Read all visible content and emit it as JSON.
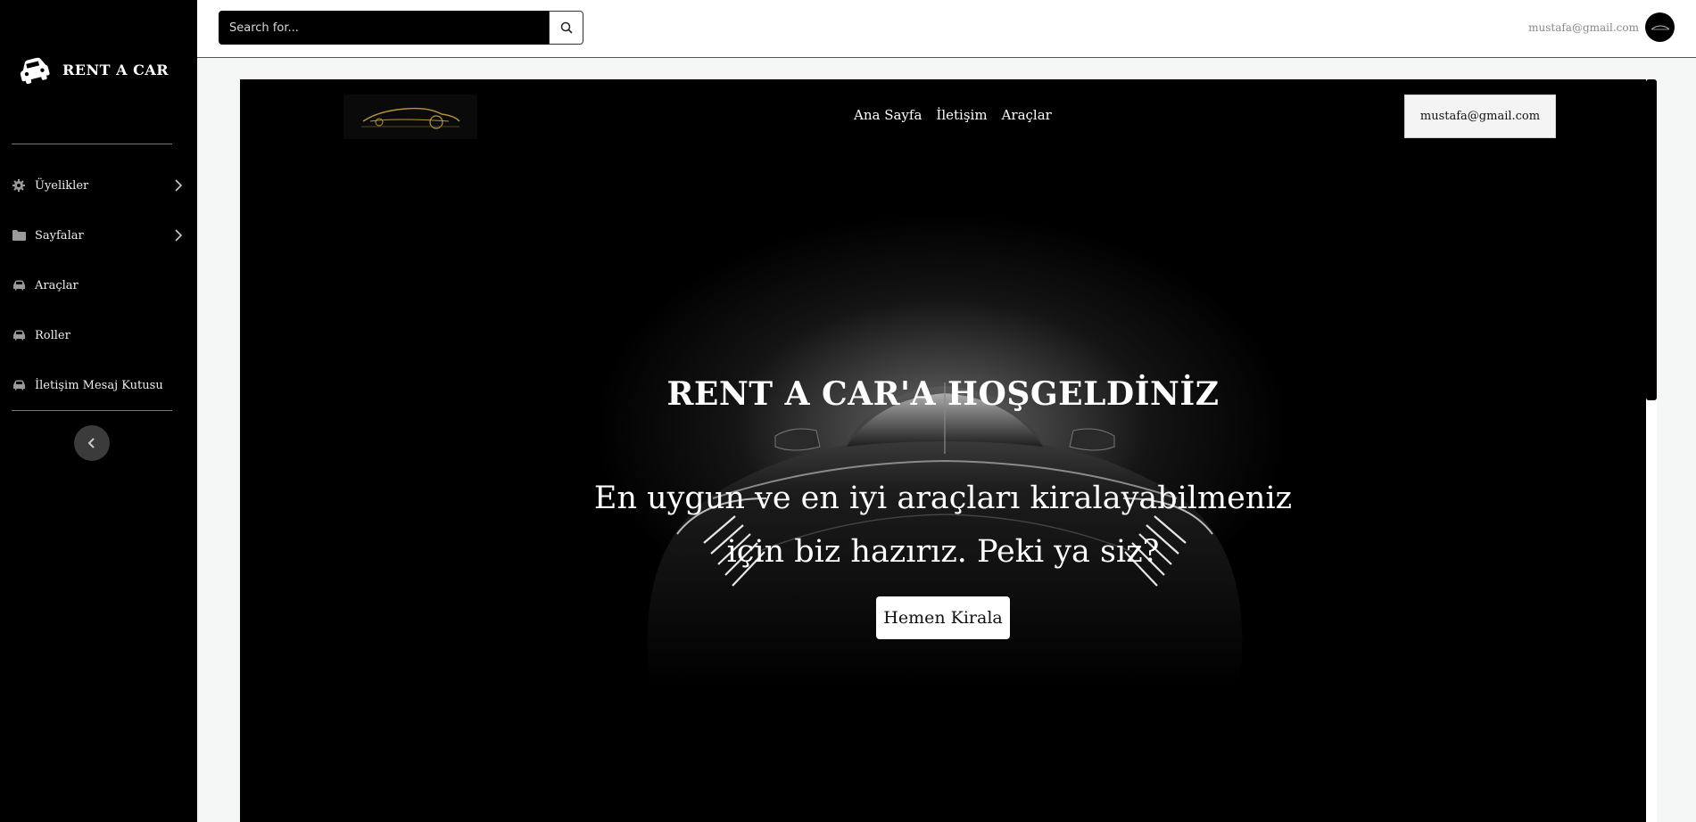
{
  "sidebar": {
    "brand": "RENT A CAR",
    "items": [
      {
        "label": "Üyelikler",
        "icon": "gear-icon",
        "has_submenu": true
      },
      {
        "label": "Sayfalar",
        "icon": "folder-icon",
        "has_submenu": true
      },
      {
        "label": "Araçlar",
        "icon": "car-icon",
        "has_submenu": false
      },
      {
        "label": "Roller",
        "icon": "car-icon",
        "has_submenu": false
      },
      {
        "label": "İletişim Mesaj Kutusu",
        "icon": "car-icon",
        "has_submenu": false
      }
    ],
    "collapse_icon": "chevron-left-icon"
  },
  "topbar": {
    "search_placeholder": "Search for...",
    "search_icon": "search-icon",
    "user_email": "mustafa@gmail.com"
  },
  "site": {
    "nav": [
      "Ana Sayfa",
      "İletişim",
      "Araçlar"
    ],
    "user_button": "mustafa@gmail.com",
    "hero_title": "RENT A CAR'A HOŞGELDİNİZ",
    "hero_subtitle_line1": "En uygun ve en iyi araçları kiralayabilmeniz",
    "hero_subtitle_line2": "için biz hazırız. Peki ya siz?",
    "cta": "Hemen Kirala"
  },
  "colors": {
    "sidebar_bg": "#000000",
    "page_bg": "#f5f7f7",
    "accent_gold": "#b8953a"
  }
}
